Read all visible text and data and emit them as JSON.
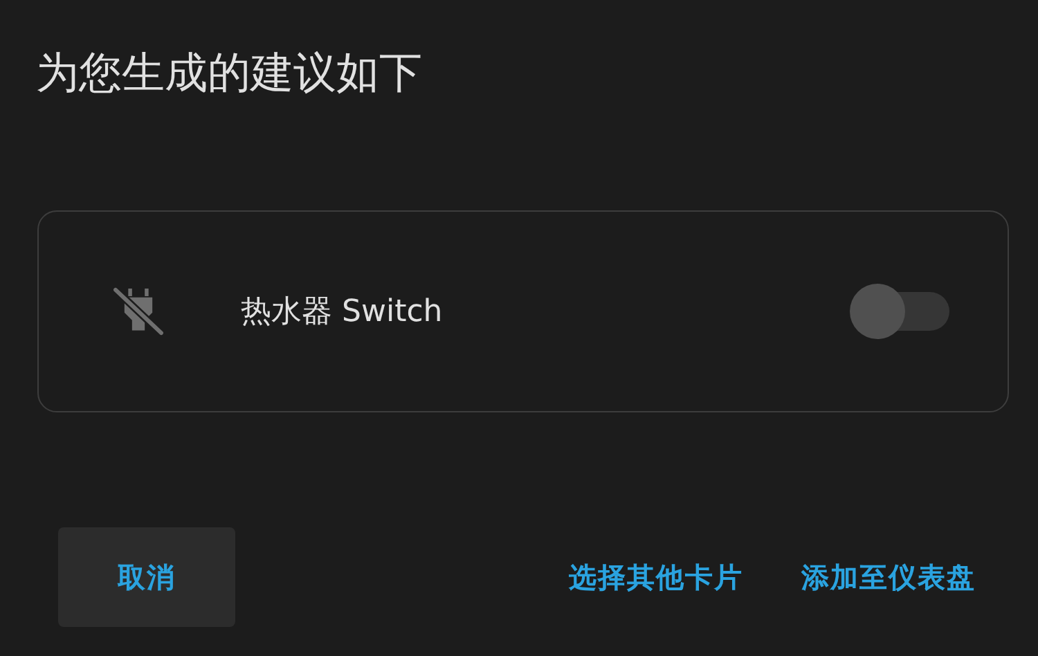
{
  "dialog": {
    "title": "为您生成的建议如下"
  },
  "entity": {
    "name": "热水器 Switch",
    "on": false
  },
  "buttons": [
    {
      "label": "取消",
      "kind": "filled"
    },
    {
      "label": "选择其他卡片",
      "kind": "text"
    },
    {
      "label": "添加至仪表盘",
      "kind": "text"
    }
  ]
}
